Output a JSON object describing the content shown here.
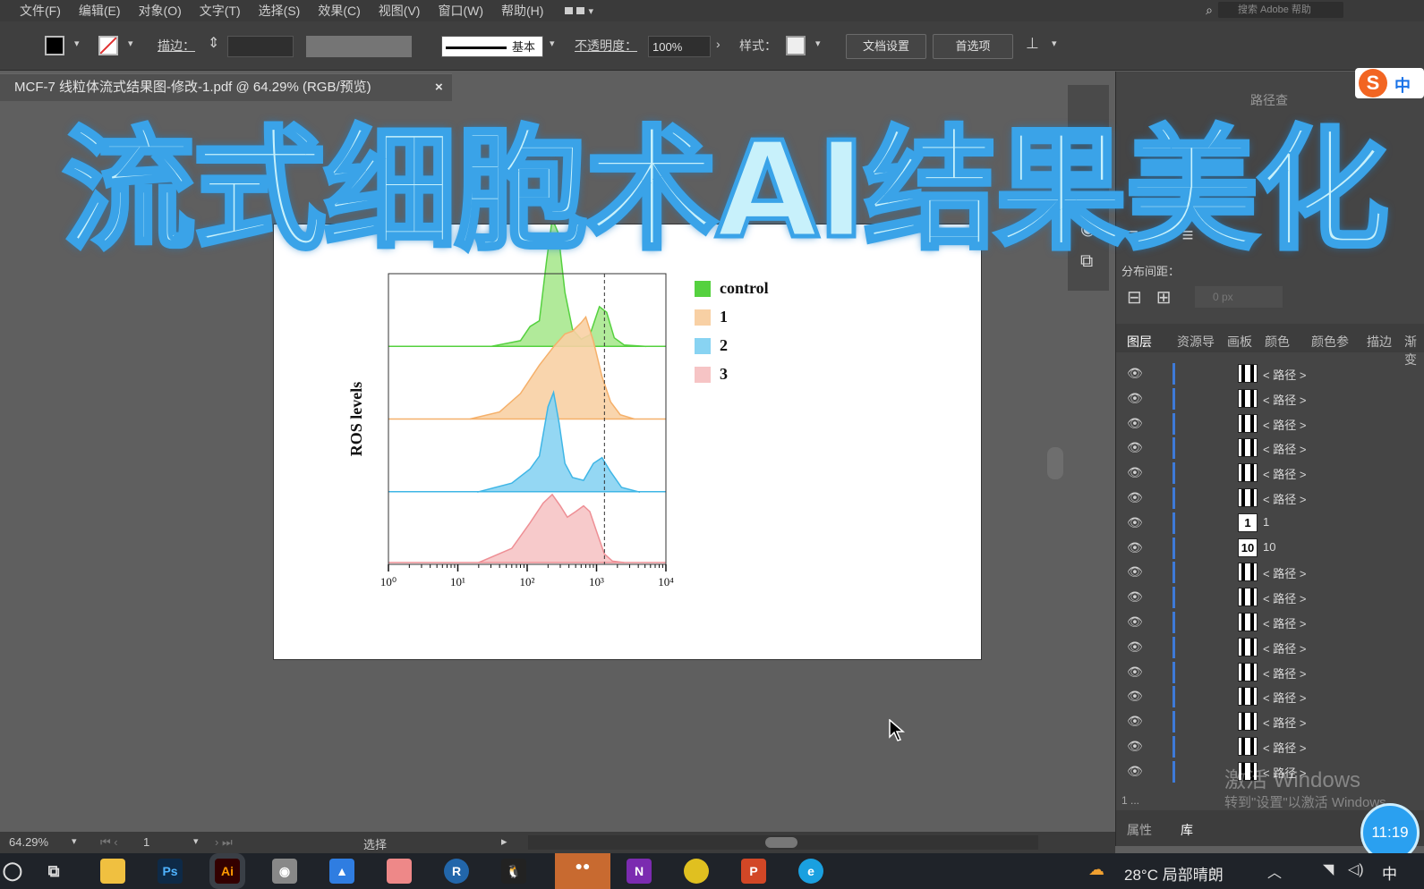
{
  "menu": [
    "文件(F)",
    "编辑(E)",
    "对象(O)",
    "文字(T)",
    "选择(S)",
    "效果(C)",
    "视图(V)",
    "窗口(W)",
    "帮助(H)"
  ],
  "search_placeholder": "搜索 Adobe 帮助",
  "control": {
    "stroke_label": "描边：",
    "stroke_style": "基本",
    "opacity_label": "不透明度：",
    "opacity_value": "100%",
    "style_label": "样式：",
    "doc_setup": "文档设置",
    "preferences": "首选项"
  },
  "document_tab": {
    "title": "MCF-7 线粒体流式结果图-修改-1.pdf @ 64.29% (RGB/预览)",
    "close": "×"
  },
  "headline": "流式细胞术AI结果美化",
  "chart_data": {
    "type": "area",
    "title": "",
    "xlabel": "",
    "ylabel": "ROS levels",
    "xscale": "log",
    "xlim": [
      1,
      10000
    ],
    "x_ticks": [
      "10⁰",
      "10¹",
      "10²",
      "10³",
      "10⁴"
    ],
    "x_tick_values": [
      1,
      10,
      100,
      1000,
      10000
    ],
    "reference_line_x": 1300,
    "legend_position": "right",
    "series": [
      {
        "name": "control",
        "color": "#55d13f",
        "fill": "#a9e88f",
        "x": [
          30,
          80,
          110,
          150,
          190,
          230,
          280,
          350,
          450,
          600,
          800,
          1100,
          1400,
          1800,
          2500,
          5000
        ],
        "y": [
          0.0,
          0.04,
          0.14,
          0.18,
          0.6,
          0.9,
          0.8,
          0.38,
          0.12,
          0.05,
          0.08,
          0.28,
          0.24,
          0.06,
          0.01,
          0.0
        ]
      },
      {
        "name": "1",
        "color": "#f5b06a",
        "fill": "#f8d0a4",
        "x": [
          15,
          40,
          80,
          150,
          250,
          350,
          450,
          600,
          700,
          900,
          1200,
          1600,
          2200,
          3500
        ],
        "y": [
          0.0,
          0.05,
          0.18,
          0.38,
          0.52,
          0.6,
          0.62,
          0.68,
          0.72,
          0.55,
          0.3,
          0.12,
          0.03,
          0.0
        ]
      },
      {
        "name": "2",
        "color": "#3fb6e6",
        "fill": "#88d3f2",
        "x": [
          20,
          60,
          110,
          150,
          200,
          240,
          290,
          350,
          450,
          650,
          900,
          1200,
          1600,
          2300,
          4000
        ],
        "y": [
          0.0,
          0.06,
          0.16,
          0.25,
          0.6,
          0.7,
          0.48,
          0.2,
          0.1,
          0.08,
          0.2,
          0.24,
          0.14,
          0.03,
          0.0
        ]
      },
      {
        "name": "3",
        "color": "#ee8f95",
        "fill": "#f6c4c5",
        "x": [
          20,
          60,
          110,
          170,
          230,
          300,
          380,
          500,
          650,
          800,
          1000,
          1300,
          1700,
          2500
        ],
        "y": [
          0.0,
          0.1,
          0.28,
          0.42,
          0.48,
          0.4,
          0.32,
          0.36,
          0.4,
          0.36,
          0.22,
          0.06,
          0.01,
          0.0
        ]
      }
    ]
  },
  "panel": {
    "top_tabs": [
      "路径查"
    ],
    "distribute_label": "分布间距：",
    "spacing_value": "0 px",
    "tabs": [
      "图层",
      "资源导",
      "画板",
      "颜色",
      "颜色参",
      "描边",
      "渐变"
    ],
    "layers": [
      {
        "thumb": "",
        "name": "< 路径 >"
      },
      {
        "thumb": "",
        "name": "< 路径 >"
      },
      {
        "thumb": "",
        "name": "< 路径 >"
      },
      {
        "thumb": "",
        "name": "< 路径 >"
      },
      {
        "thumb": "",
        "name": "< 路径 >"
      },
      {
        "thumb": "",
        "name": "< 路径 >"
      },
      {
        "thumb": "1",
        "name": "1"
      },
      {
        "thumb": "10",
        "name": "10"
      },
      {
        "thumb": "",
        "name": "< 路径 >"
      },
      {
        "thumb": "",
        "name": "< 路径 >"
      },
      {
        "thumb": "",
        "name": "< 路径 >"
      },
      {
        "thumb": "",
        "name": "< 路径 >"
      },
      {
        "thumb": "",
        "name": "< 路径 >"
      },
      {
        "thumb": "",
        "name": "< 路径 >"
      },
      {
        "thumb": "",
        "name": "< 路径 >"
      },
      {
        "thumb": "",
        "name": "< 路径 >"
      },
      {
        "thumb": "",
        "name": "< 路径 >"
      }
    ],
    "layers_footer": "1 ...",
    "bottom_tabs": [
      "属性",
      "库"
    ]
  },
  "status": {
    "zoom": "64.29%",
    "artboard": "1",
    "tool": "选择"
  },
  "watermark": {
    "line1": "激活 Windows",
    "line2": "转到\"设置\"以激活 Windows"
  },
  "clock": "11:19",
  "taskbar": {
    "weather": "28°C 局部晴朗",
    "ime": "中"
  },
  "ime_logo": "中"
}
